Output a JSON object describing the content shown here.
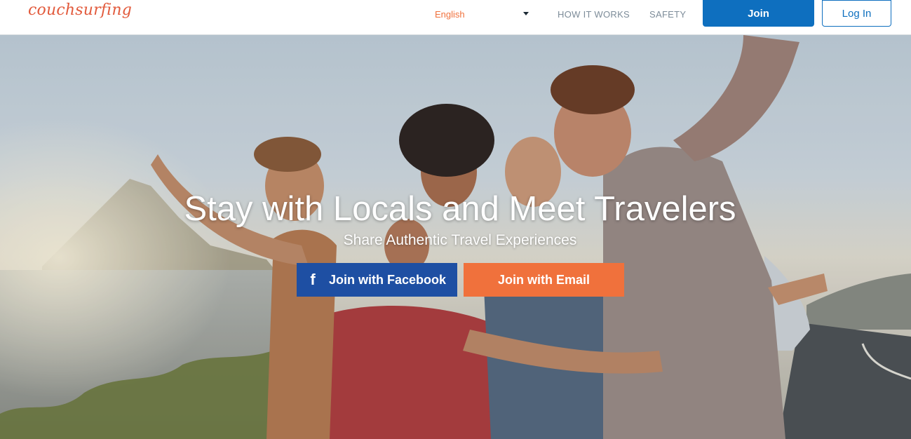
{
  "header": {
    "logo_text": "couchsurfing",
    "language": "English",
    "nav": {
      "how_it_works": "HOW IT WORKS",
      "safety": "SAFETY"
    },
    "join_label": "Join",
    "login_label": "Log In"
  },
  "hero": {
    "headline": "Stay with Locals and Meet Travelers",
    "subheadline": "Share Authentic Travel Experiences",
    "facebook_icon": "f",
    "facebook_button": "Join with Facebook",
    "email_button": "Join with Email"
  },
  "colors": {
    "brand_orange": "#f0713c",
    "brand_blue": "#0e6fbf",
    "facebook_blue": "#1e4fa3"
  },
  "icons": {
    "facebook": "facebook-icon",
    "language_caret": "caret-down-icon"
  }
}
